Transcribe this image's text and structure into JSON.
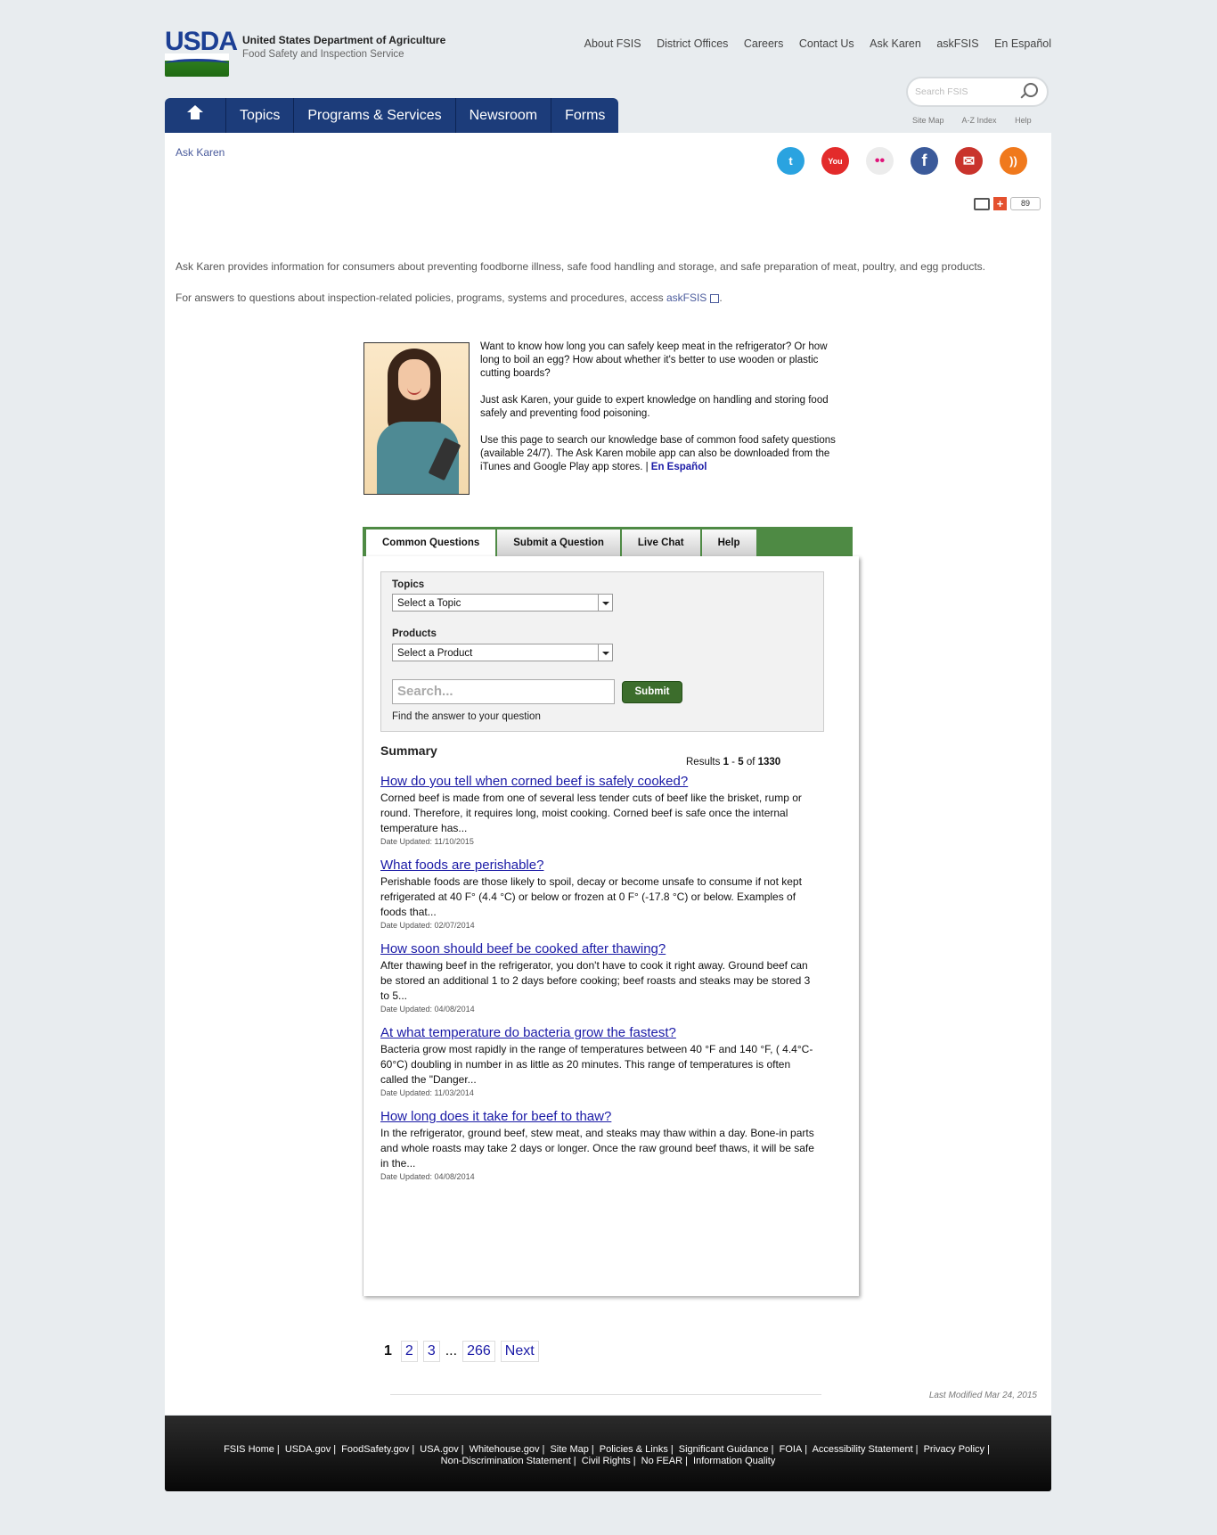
{
  "header": {
    "logo_text": "USDA",
    "org_line1": "United States Department of Agriculture",
    "org_line2": "Food Safety and Inspection Service",
    "top_links": [
      "About FSIS",
      "District Offices",
      "Careers",
      "Contact Us",
      "Ask Karen",
      "askFSIS",
      "En Español"
    ],
    "search_placeholder": "Search FSIS",
    "util_links": [
      "Site Map",
      "A-Z Index",
      "Help"
    ]
  },
  "nav": {
    "items": [
      "Topics",
      "Programs & Services",
      "Newsroom",
      "Forms"
    ]
  },
  "breadcrumb": "Ask Karen",
  "social": [
    {
      "name": "twitter",
      "glyph": "t",
      "color": "#2aa3e0"
    },
    {
      "name": "youtube",
      "glyph": "You",
      "color": "#e32b2b"
    },
    {
      "name": "flickr",
      "glyph": "••",
      "color": "#e9e9e9"
    },
    {
      "name": "facebook",
      "glyph": "f",
      "color": "#3b5a9a"
    },
    {
      "name": "email",
      "glyph": "✉",
      "color": "#c9332c"
    },
    {
      "name": "rss",
      "glyph": "))",
      "color": "#f0791c"
    }
  ],
  "share_count": "89",
  "intro": {
    "line1": "Ask Karen provides information for consumers about preventing foodborne illness, safe food handling and storage, and safe preparation of meat, poultry, and egg products.",
    "line2_prefix": "For answers to questions about inspection-related policies, programs, systems and procedures, access",
    "line2_link": "askFSIS",
    "line2_suffix": "."
  },
  "karen": {
    "p1": "Want to know how long you can safely keep meat in the refrigerator? Or how long to boil an egg? How about whether it's better to use wooden or plastic cutting boards?",
    "p2": "Just ask Karen, your guide to expert knowledge on handling and storing food safely and preventing food poisoning.",
    "p3": "Use this page to search our knowledge base of common food safety questions (available 24/7). The Ask Karen mobile app can also be downloaded from the iTunes and Google Play app stores. |",
    "p3_link": "En Español"
  },
  "tabs": [
    "Common Questions",
    "Submit a Question",
    "Live Chat",
    "Help"
  ],
  "filters": {
    "topics_label": "Topics",
    "topics_value": "Select a Topic",
    "products_label": "Products",
    "products_value": "Select a Product",
    "search_placeholder": "Search...",
    "submit_label": "Submit",
    "hint": "Find the answer to your question"
  },
  "summary": {
    "title": "Summary",
    "results_prefix": "Results",
    "from": "1",
    "to": "5",
    "of_text": "of",
    "total": "1330"
  },
  "questions": [
    {
      "title": "How do you tell when corned beef is safely cooked?",
      "snippet": "Corned beef is made from one of several less tender cuts of beef like the brisket, rump or round. Therefore, it requires long, moist cooking. Corned beef is safe once the internal temperature has...",
      "date": "Date Updated: 11/10/2015"
    },
    {
      "title": "What foods are perishable?",
      "snippet": "Perishable foods are those likely to spoil, decay or become unsafe to consume if not kept refrigerated at 40 F° (4.4 °C) or below or frozen at 0 F° (-17.8 °C) or below. Examples of foods that...",
      "date": "Date Updated: 02/07/2014"
    },
    {
      "title": "How soon should beef be cooked after thawing?",
      "snippet": "After thawing beef in the refrigerator, you don't have to cook it right away. Ground beef can be stored an additional 1 to 2 days before cooking; beef roasts and steaks may be stored 3 to 5...",
      "date": "Date Updated: 04/08/2014"
    },
    {
      "title": "At what temperature do bacteria grow the fastest?",
      "snippet": "Bacteria grow most rapidly in the range of temperatures between 40 °F and 140 °F, ( 4.4°C- 60°C) doubling in number in as little as 20 minutes. This range of temperatures is often called the \"Danger...",
      "date": "Date Updated: 11/03/2014"
    },
    {
      "title": "How long does it take for beef to thaw?",
      "snippet": "In the refrigerator, ground beef, stew meat, and steaks may thaw within a day. Bone-in parts and whole roasts may take 2 days or longer. Once the raw ground beef thaws, it will be safe in the...",
      "date": "Date Updated: 04/08/2014"
    }
  ],
  "pager": {
    "current": "1",
    "pages": [
      "2",
      "3"
    ],
    "ellipsis": "...",
    "last": "266",
    "next": "Next"
  },
  "last_modified": "Last Modified Mar 24, 2015",
  "footer": {
    "row1": [
      "FSIS Home",
      "USDA.gov",
      "FoodSafety.gov",
      "USA.gov",
      "Whitehouse.gov",
      "Site Map",
      "Policies & Links",
      "Significant Guidance",
      "FOIA",
      "Accessibility Statement",
      "Privacy Policy"
    ],
    "row2": [
      "Non-Discrimination Statement",
      "Civil Rights",
      "No FEAR",
      "Information Quality"
    ]
  }
}
